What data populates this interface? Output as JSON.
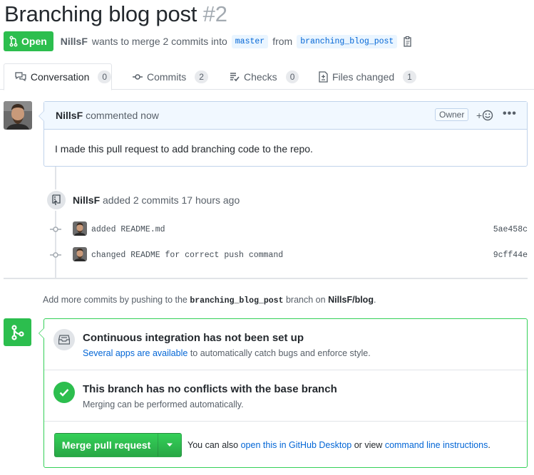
{
  "pr": {
    "title": "Branching blog post",
    "number": "#2",
    "state": "Open",
    "author": "NillsF",
    "merge_text": "wants to merge 2 commits into",
    "base_branch": "master",
    "from_text": "from",
    "head_branch": "branching_blog_post"
  },
  "tabs": [
    {
      "label": "Conversation",
      "count": "0",
      "icon": "comment-discussion-icon"
    },
    {
      "label": "Commits",
      "count": "2",
      "icon": "git-commit-icon"
    },
    {
      "label": "Checks",
      "count": "0",
      "icon": "checklist-icon"
    },
    {
      "label": "Files changed",
      "count": "1",
      "icon": "file-diff-icon"
    }
  ],
  "comment": {
    "author": "NillsF",
    "meta": "commented now",
    "badge": "Owner",
    "reaction_plus": "+",
    "more": "•••",
    "body": "I made this pull request to add branching code to the repo."
  },
  "push_event": {
    "author": "NillsF",
    "text": "added 2 commits 17 hours ago"
  },
  "commits": [
    {
      "message": "added README.md",
      "sha": "5ae458c"
    },
    {
      "message": "changed README for correct push command",
      "sha": "9cff44e"
    }
  ],
  "hint": {
    "prefix": "Add more commits by pushing to the",
    "branch": "branching_blog_post",
    "middle": "branch on",
    "repo": "NillsF/blog",
    "suffix": "."
  },
  "merge_box": {
    "ci_title": "Continuous integration has not been set up",
    "ci_link": "Several apps are available",
    "ci_rest": "to automatically catch bugs and enforce style.",
    "conflict_title": "This branch has no conflicts with the base branch",
    "conflict_sub": "Merging can be performed automatically.",
    "merge_button": "Merge pull request",
    "note_prefix": "You can also",
    "note_link1": "open this in GitHub Desktop",
    "note_middle": "or view",
    "note_link2": "command line instructions",
    "note_suffix": "."
  },
  "colors": {
    "open_green": "#2cbe4e",
    "link_blue": "#0366d6",
    "comment_border": "#c0d3eb",
    "merge_border": "#34d058"
  }
}
